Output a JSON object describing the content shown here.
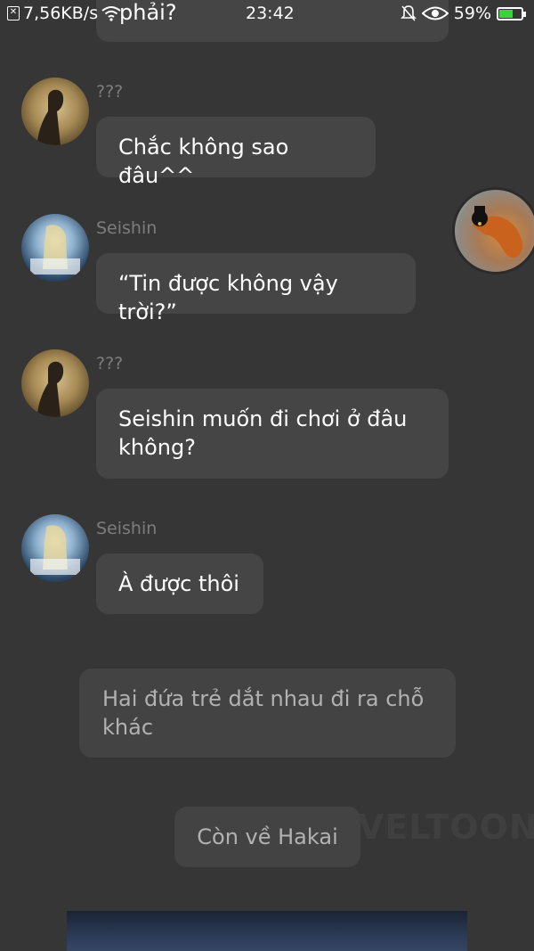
{
  "status_bar": {
    "speed": "7,56KB/s",
    "time": "23:42",
    "battery": "59%",
    "battery_level": 0.59
  },
  "messages": [
    {
      "type": "bubble",
      "text": "phải?"
    },
    {
      "type": "chat",
      "speaker": "???",
      "avatar_icon": "silhouette-avatar-icon",
      "text": "Chắc không sao đâu^^"
    },
    {
      "type": "chat",
      "speaker": "Seishin",
      "avatar_icon": "anime-girl-avatar-icon",
      "text": "“Tin được không vậy trời?”"
    },
    {
      "type": "chat",
      "speaker": "???",
      "avatar_icon": "silhouette-avatar-icon",
      "text": "Seishin muốn đi chơi ở đâu không?"
    },
    {
      "type": "chat",
      "speaker": "Seishin",
      "avatar_icon": "anime-girl-avatar-icon",
      "text": "À được thôi"
    },
    {
      "type": "narration",
      "text": "Hai đứa trẻ dắt nhau đi ra chỗ khác"
    },
    {
      "type": "narration",
      "text": "Còn về Hakai"
    }
  ],
  "watermark": "VELTOON",
  "colors": {
    "background": "#363636",
    "bubble": "#454545",
    "name": "#7d7d7d",
    "narration_text": "#b2b2b2",
    "battery_fill": "#3ad33a"
  }
}
